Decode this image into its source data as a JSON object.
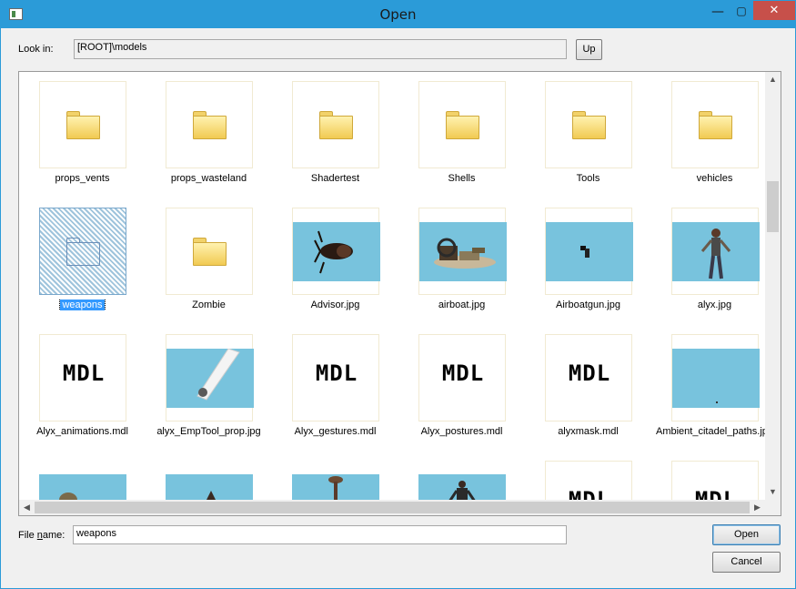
{
  "window": {
    "title": "Open"
  },
  "titlebar": {
    "minimize": "—",
    "maximize": "▢",
    "close": "✕"
  },
  "lookin": {
    "label": "Look in:",
    "path": "[ROOT]\\models",
    "up_button": "Up"
  },
  "items": [
    {
      "name": "props_vents",
      "type": "folder",
      "icon": "folder-icon"
    },
    {
      "name": "props_wasteland",
      "type": "folder",
      "icon": "folder-icon"
    },
    {
      "name": "Shadertest",
      "type": "folder",
      "icon": "folder-icon"
    },
    {
      "name": "Shells",
      "type": "folder",
      "icon": "folder-icon"
    },
    {
      "name": "Tools",
      "type": "folder",
      "icon": "folder-icon"
    },
    {
      "name": "vehicles",
      "type": "folder",
      "icon": "folder-icon"
    },
    {
      "name": "weapons",
      "type": "folder",
      "icon": "folder-icon",
      "selected": true
    },
    {
      "name": "Zombie",
      "type": "folder",
      "icon": "folder-icon"
    },
    {
      "name": "Advisor.jpg",
      "type": "image",
      "icon": "advisor-thumbnail"
    },
    {
      "name": "airboat.jpg",
      "type": "image",
      "icon": "airboat-thumbnail"
    },
    {
      "name": "Airboatgun.jpg",
      "type": "image",
      "icon": "airboatgun-thumbnail"
    },
    {
      "name": "alyx.jpg",
      "type": "image",
      "icon": "alyx-thumbnail"
    },
    {
      "name": "Alyx_animations.mdl",
      "type": "mdl",
      "thumb_text": "MDL"
    },
    {
      "name": "alyx_EmpTool_prop.jpg",
      "type": "image",
      "icon": "emptool-thumbnail"
    },
    {
      "name": "Alyx_gestures.mdl",
      "type": "mdl",
      "thumb_text": "MDL"
    },
    {
      "name": "Alyx_postures.mdl",
      "type": "mdl",
      "thumb_text": "MDL"
    },
    {
      "name": "alyxmask.mdl",
      "type": "mdl",
      "thumb_text": "MDL"
    },
    {
      "name": "Ambient_citadel_paths.jpg",
      "type": "image",
      "icon": "citadel-thumbnail"
    }
  ],
  "filename": {
    "label_prefix": "File ",
    "label_key": "n",
    "label_suffix": "ame:",
    "value": "weapons"
  },
  "buttons": {
    "open": "Open",
    "cancel": "Cancel"
  },
  "scroll": {
    "up": "▲",
    "down": "▼",
    "left": "◀",
    "right": "▶"
  },
  "colors": {
    "titlebar": "#2b9bd8",
    "thumbnail_bg": "#78c3dd",
    "selection": "#3399ff",
    "close": "#c7504a"
  }
}
